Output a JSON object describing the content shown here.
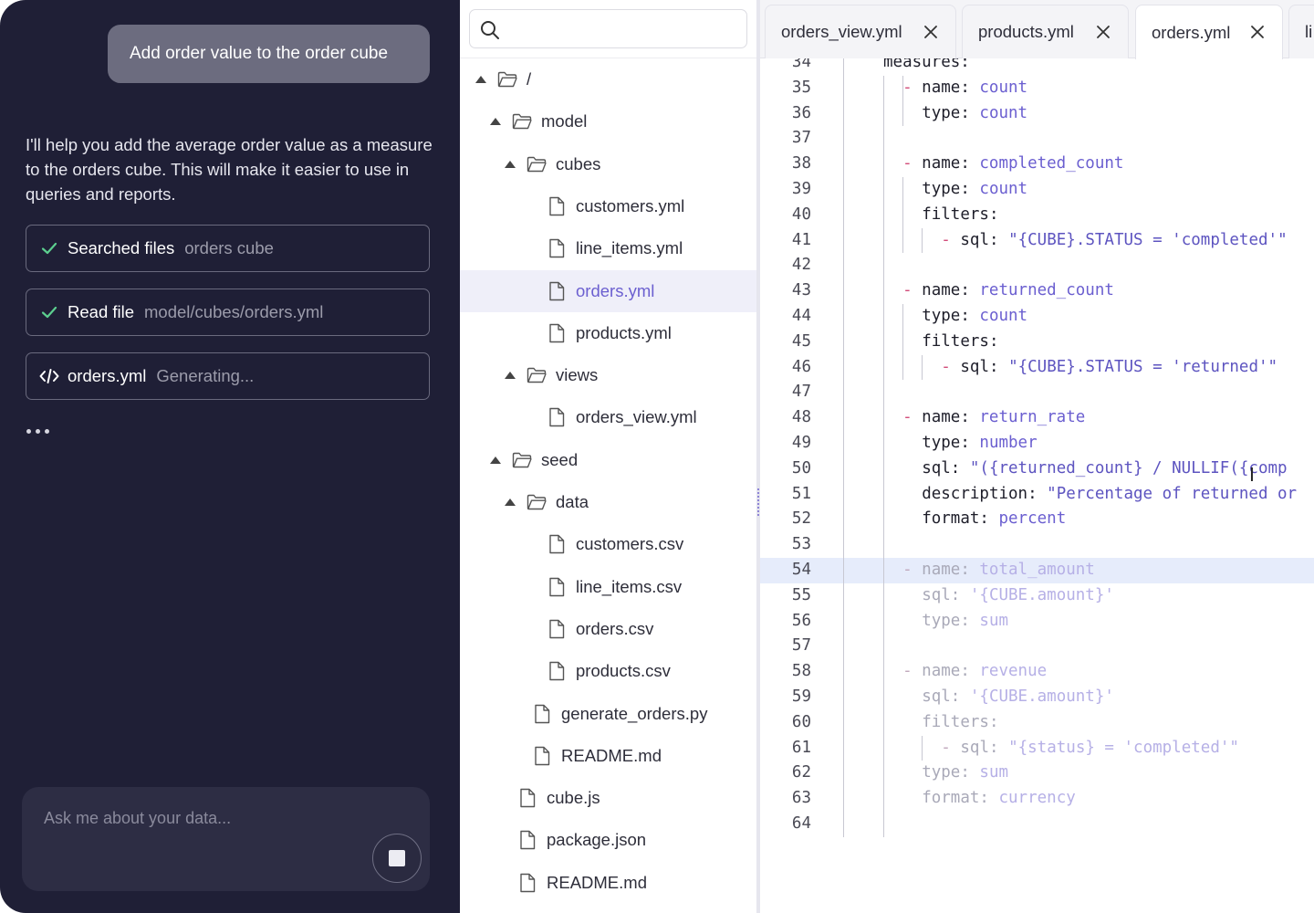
{
  "chat": {
    "user_message": "Add order value to the order cube",
    "assistant_text": "I'll help you add the average order value as a measure to the orders cube. This will make it easier to use in queries and reports.",
    "steps": [
      {
        "icon": "check-icon",
        "label": "Searched files",
        "detail": "orders cube"
      },
      {
        "icon": "check-icon",
        "label": "Read file",
        "detail": "model/cubes/orders.yml"
      },
      {
        "icon": "code-icon",
        "label": "orders.yml",
        "detail": "Generating..."
      }
    ],
    "composer_placeholder": "Ask me about your data..."
  },
  "tree": {
    "search_placeholder": "",
    "items": [
      {
        "label": "/",
        "type": "folder",
        "depth": 0,
        "expanded": true
      },
      {
        "label": "model",
        "type": "folder",
        "depth": 1,
        "expanded": true
      },
      {
        "label": "cubes",
        "type": "folder",
        "depth": 2,
        "expanded": true
      },
      {
        "label": "customers.yml",
        "type": "file",
        "depth": 3
      },
      {
        "label": "line_items.yml",
        "type": "file",
        "depth": 3
      },
      {
        "label": "orders.yml",
        "type": "file",
        "depth": 3,
        "selected": true
      },
      {
        "label": "products.yml",
        "type": "file",
        "depth": 3
      },
      {
        "label": "views",
        "type": "folder",
        "depth": 2,
        "expanded": true
      },
      {
        "label": "orders_view.yml",
        "type": "file",
        "depth": 3
      },
      {
        "label": "seed",
        "type": "folder",
        "depth": 1,
        "expanded": true
      },
      {
        "label": "data",
        "type": "folder",
        "depth": 2,
        "expanded": true
      },
      {
        "label": "customers.csv",
        "type": "file",
        "depth": 3
      },
      {
        "label": "line_items.csv",
        "type": "file",
        "depth": 3
      },
      {
        "label": "orders.csv",
        "type": "file",
        "depth": 3
      },
      {
        "label": "products.csv",
        "type": "file",
        "depth": 3
      },
      {
        "label": "generate_orders.py",
        "type": "file",
        "depth": 2
      },
      {
        "label": "README.md",
        "type": "file",
        "depth": 2
      },
      {
        "label": "cube.js",
        "type": "file",
        "depth": 1
      },
      {
        "label": "package.json",
        "type": "file",
        "depth": 1
      },
      {
        "label": "README.md",
        "type": "file",
        "depth": 1
      }
    ]
  },
  "editor": {
    "tabs": [
      {
        "label": "orders_view.yml",
        "active": false
      },
      {
        "label": "products.yml",
        "active": false
      },
      {
        "label": "orders.yml",
        "active": true
      },
      {
        "label": "li",
        "active": false
      }
    ],
    "lines": [
      {
        "n": "34",
        "indent": 0,
        "parts": [
          [
            "k",
            "measures:"
          ]
        ]
      },
      {
        "n": "35",
        "indent": 1,
        "parts": [
          [
            "dash",
            "- "
          ],
          [
            "k",
            "name: "
          ],
          [
            "v",
            "count"
          ]
        ]
      },
      {
        "n": "36",
        "indent": 2,
        "parts": [
          [
            "k",
            "type: "
          ],
          [
            "v",
            "count"
          ]
        ]
      },
      {
        "n": "37",
        "indent": 0,
        "parts": []
      },
      {
        "n": "38",
        "indent": 1,
        "parts": [
          [
            "dash",
            "- "
          ],
          [
            "k",
            "name: "
          ],
          [
            "v",
            "completed_count"
          ]
        ]
      },
      {
        "n": "39",
        "indent": 2,
        "parts": [
          [
            "k",
            "type: "
          ],
          [
            "v",
            "count"
          ]
        ]
      },
      {
        "n": "40",
        "indent": 2,
        "parts": [
          [
            "k",
            "filters:"
          ]
        ]
      },
      {
        "n": "41",
        "indent": 3,
        "parts": [
          [
            "dash",
            "- "
          ],
          [
            "k",
            "sql: "
          ],
          [
            "s",
            "\"{CUBE}.STATUS = 'completed'\""
          ]
        ]
      },
      {
        "n": "42",
        "indent": 0,
        "parts": []
      },
      {
        "n": "43",
        "indent": 1,
        "parts": [
          [
            "dash",
            "- "
          ],
          [
            "k",
            "name: "
          ],
          [
            "v",
            "returned_count"
          ]
        ]
      },
      {
        "n": "44",
        "indent": 2,
        "parts": [
          [
            "k",
            "type: "
          ],
          [
            "v",
            "count"
          ]
        ]
      },
      {
        "n": "45",
        "indent": 2,
        "parts": [
          [
            "k",
            "filters:"
          ]
        ]
      },
      {
        "n": "46",
        "indent": 3,
        "parts": [
          [
            "dash",
            "- "
          ],
          [
            "k",
            "sql: "
          ],
          [
            "s",
            "\"{CUBE}.STATUS = 'returned'\""
          ]
        ]
      },
      {
        "n": "47",
        "indent": 0,
        "parts": []
      },
      {
        "n": "48",
        "indent": 1,
        "parts": [
          [
            "dash",
            "- "
          ],
          [
            "k",
            "name: "
          ],
          [
            "v",
            "return_rate"
          ]
        ]
      },
      {
        "n": "49",
        "indent": 2,
        "parts": [
          [
            "k",
            "type: "
          ],
          [
            "v",
            "number"
          ]
        ]
      },
      {
        "n": "50",
        "indent": 2,
        "parts": [
          [
            "k",
            "sql: "
          ],
          [
            "s",
            "\"({returned_count} / NULLIF({comp"
          ]
        ]
      },
      {
        "n": "51",
        "indent": 2,
        "parts": [
          [
            "k",
            "description: "
          ],
          [
            "s",
            "\"Percentage of returned or"
          ]
        ]
      },
      {
        "n": "52",
        "indent": 2,
        "parts": [
          [
            "k",
            "format: "
          ],
          [
            "v",
            "percent"
          ]
        ]
      },
      {
        "n": "53",
        "indent": 0,
        "parts": []
      },
      {
        "n": "54",
        "indent": 1,
        "faded": true,
        "highlight": true,
        "parts": [
          [
            "dash",
            "- "
          ],
          [
            "k",
            "name: "
          ],
          [
            "v",
            "total_amount"
          ]
        ]
      },
      {
        "n": "55",
        "indent": 2,
        "faded": true,
        "parts": [
          [
            "k",
            "sql: "
          ],
          [
            "s",
            "'{CUBE.amount}'"
          ]
        ]
      },
      {
        "n": "56",
        "indent": 2,
        "faded": true,
        "parts": [
          [
            "k",
            "type: "
          ],
          [
            "v",
            "sum"
          ]
        ]
      },
      {
        "n": "57",
        "indent": 0,
        "faded": true,
        "parts": []
      },
      {
        "n": "58",
        "indent": 1,
        "faded": true,
        "parts": [
          [
            "dash",
            "- "
          ],
          [
            "k",
            "name: "
          ],
          [
            "v",
            "revenue"
          ]
        ]
      },
      {
        "n": "59",
        "indent": 2,
        "faded": true,
        "parts": [
          [
            "k",
            "sql: "
          ],
          [
            "s",
            "'{CUBE.amount}'"
          ]
        ]
      },
      {
        "n": "60",
        "indent": 2,
        "faded": true,
        "parts": [
          [
            "k",
            "filters:"
          ]
        ]
      },
      {
        "n": "61",
        "indent": 3,
        "faded": true,
        "parts": [
          [
            "dash",
            "- "
          ],
          [
            "k",
            "sql: "
          ],
          [
            "s",
            "\"{status} = 'completed'\""
          ]
        ]
      },
      {
        "n": "62",
        "indent": 2,
        "faded": true,
        "parts": [
          [
            "k",
            "type: "
          ],
          [
            "v",
            "sum"
          ]
        ]
      },
      {
        "n": "63",
        "indent": 2,
        "faded": true,
        "parts": [
          [
            "k",
            "format: "
          ],
          [
            "v",
            "currency"
          ]
        ]
      },
      {
        "n": "64",
        "indent": 0,
        "parts": []
      }
    ]
  },
  "colors": {
    "chat_bg": "#1f1f36",
    "accent": "#6b5fd0",
    "selection": "#efeff9",
    "line_highlight": "#e6ecfb"
  }
}
